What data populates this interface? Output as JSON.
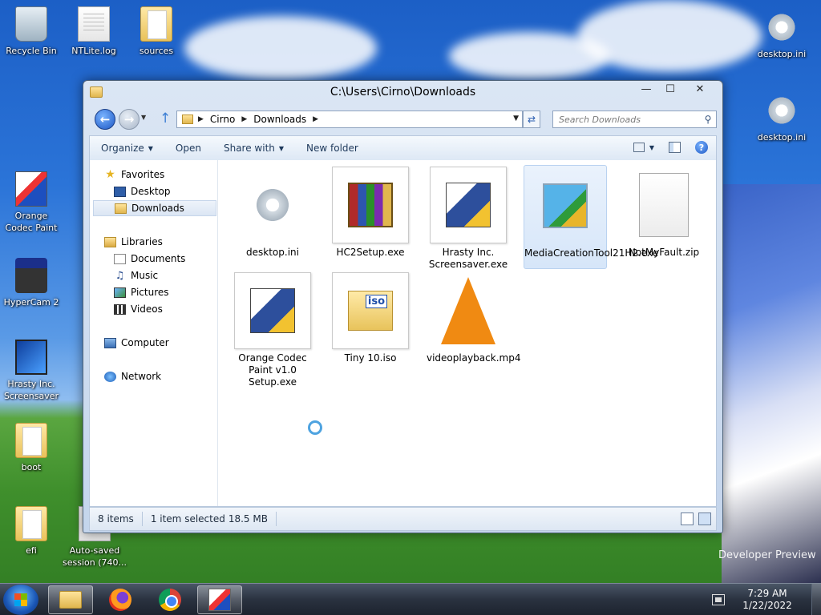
{
  "desktop": {
    "icons": [
      {
        "label": "Recycle Bin"
      },
      {
        "label": "NTLite.log"
      },
      {
        "label": "sources"
      },
      {
        "label": "desktop.ini"
      },
      {
        "label": "desktop.ini"
      },
      {
        "label": "Orange Codec Paint"
      },
      {
        "label": "HyperCam 2"
      },
      {
        "label": "Hrasty Inc. Screensaver"
      },
      {
        "label": "boot"
      },
      {
        "label": "efi"
      },
      {
        "label": "Auto-saved session (740..."
      }
    ],
    "wallpaper_texts": {
      "developer_preview": "Developer Preview"
    }
  },
  "window": {
    "title": "C:\\Users\\Cirno\\Downloads",
    "controls": {
      "minimize": "—",
      "maximize": "☐",
      "close": "✕"
    },
    "address": {
      "crumbs": [
        "Cirno",
        "Downloads"
      ]
    },
    "search": {
      "placeholder": "Search Downloads"
    },
    "toolbar": {
      "organize": "Organize",
      "open": "Open",
      "share_with": "Share with",
      "new_folder": "New folder"
    },
    "nav": {
      "favorites": "Favorites",
      "desktop": "Desktop",
      "downloads": "Downloads",
      "libraries": "Libraries",
      "documents": "Documents",
      "music": "Music",
      "pictures": "Pictures",
      "videos": "Videos",
      "computer": "Computer",
      "network": "Network"
    },
    "files": [
      {
        "name": "desktop.ini"
      },
      {
        "name": "HC2Setup.exe"
      },
      {
        "name": "Hrasty Inc. Screensaver.exe"
      },
      {
        "name": "MediaCreationTool21H2.exe"
      },
      {
        "name": "NotMyFault.zip"
      },
      {
        "name": "Orange Codec Paint v1.0 Setup.exe"
      },
      {
        "name": "Tiny 10.iso"
      },
      {
        "name": "videoplayback.mp4"
      }
    ],
    "status": {
      "items": "8 items",
      "selected": "1 item selected",
      "size": "18.5 MB"
    }
  },
  "taskbar": {
    "clock": {
      "time": "7:29 AM",
      "date": "1/22/2022"
    }
  }
}
